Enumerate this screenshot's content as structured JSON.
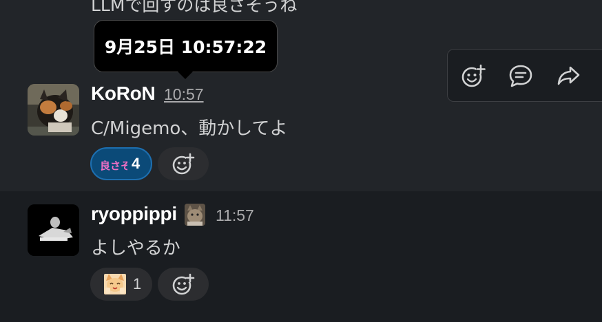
{
  "previous_message": {
    "text": "LLMで回すのは良さそうね"
  },
  "tooltip": {
    "timestamp": "9月25日 10:57:22"
  },
  "message_actions": {
    "icons": [
      "add-reaction-icon",
      "reply-in-thread-icon",
      "share-message-icon"
    ]
  },
  "messages": [
    {
      "author": "KoRoN",
      "time": "10:57",
      "text": "C/Migemo、動かしてよ",
      "reaction": {
        "emoji_text": "良さそう",
        "count": "4",
        "reacted_by_me": true
      }
    },
    {
      "author": "ryoppippi",
      "time": "11:57",
      "text": "よしやるか",
      "reaction": {
        "emoji": "cat-emoji",
        "count": "1",
        "reacted_by_me": false
      }
    }
  ],
  "colors": {
    "background": "#1a1d21",
    "highlight_row": "#222529",
    "reaction_active_bg": "#0b4a78",
    "reaction_active_border": "#1d6fb0",
    "pink_emoji_text": "#f06fc4"
  }
}
